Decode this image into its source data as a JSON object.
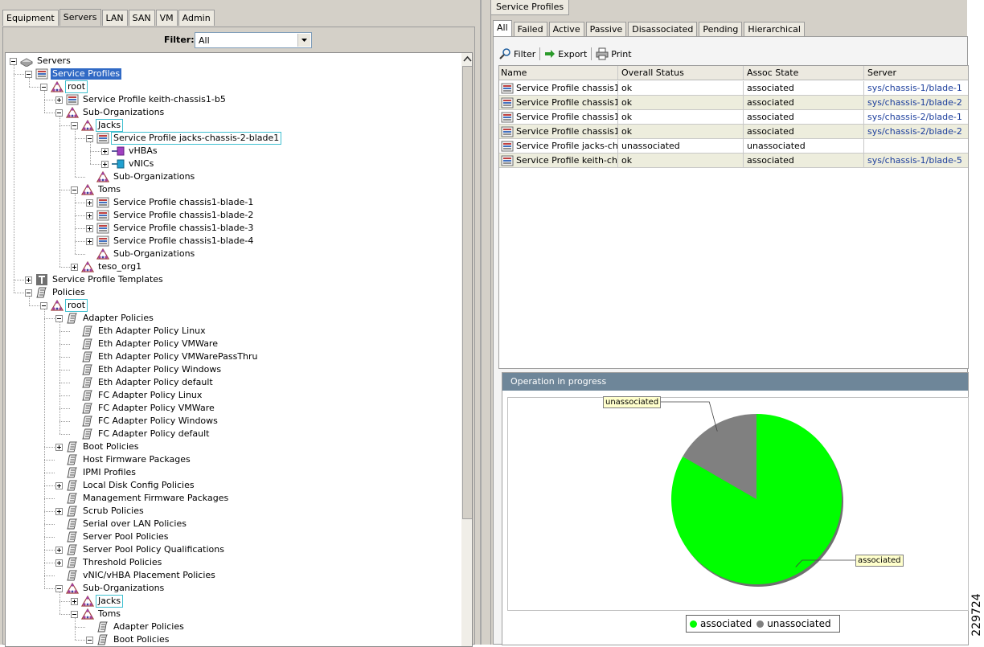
{
  "left_tabs": [
    "Equipment",
    "Servers",
    "LAN",
    "SAN",
    "VM",
    "Admin"
  ],
  "left_active_tab": "Servers",
  "filter": {
    "label": "Filter:",
    "value": "All"
  },
  "tree": [
    {
      "label": "Servers",
      "icon": "server-icon",
      "depth": 0,
      "exp": "minus",
      "style": ""
    },
    {
      "label": "Service Profiles",
      "icon": "service-profile-icon",
      "depth": 1,
      "exp": "minus",
      "style": "sel"
    },
    {
      "label": "root",
      "icon": "org-icon",
      "depth": 2,
      "exp": "minus",
      "style": "box"
    },
    {
      "label": "Service Profile keith-chassis1-b5",
      "icon": "service-profile-icon",
      "depth": 3,
      "exp": "plus",
      "style": ""
    },
    {
      "label": "Sub-Organizations",
      "icon": "org-icon",
      "depth": 3,
      "exp": "minus",
      "style": ""
    },
    {
      "label": "Jacks",
      "icon": "org-icon",
      "depth": 4,
      "exp": "minus",
      "style": "box"
    },
    {
      "label": "Service Profile jacks-chassis-2-blade1",
      "icon": "service-profile-icon",
      "depth": 5,
      "exp": "minus",
      "style": "box"
    },
    {
      "label": "vHBAs",
      "icon": "vhba-icon",
      "depth": 6,
      "exp": "plus",
      "style": ""
    },
    {
      "label": "vNICs",
      "icon": "vnic-icon",
      "depth": 6,
      "exp": "plus",
      "style": ""
    },
    {
      "label": "Sub-Organizations",
      "icon": "org-icon",
      "depth": 5,
      "exp": "none",
      "style": ""
    },
    {
      "label": "Toms",
      "icon": "org-icon",
      "depth": 4,
      "exp": "minus",
      "style": ""
    },
    {
      "label": "Service Profile chassis1-blade-1",
      "icon": "service-profile-icon",
      "depth": 5,
      "exp": "plus",
      "style": ""
    },
    {
      "label": "Service Profile chassis1-blade-2",
      "icon": "service-profile-icon",
      "depth": 5,
      "exp": "plus",
      "style": ""
    },
    {
      "label": "Service Profile chassis1-blade-3",
      "icon": "service-profile-icon",
      "depth": 5,
      "exp": "plus",
      "style": ""
    },
    {
      "label": "Service Profile chassis1-blade-4",
      "icon": "service-profile-icon",
      "depth": 5,
      "exp": "plus",
      "style": ""
    },
    {
      "label": "Sub-Organizations",
      "icon": "org-icon",
      "depth": 5,
      "exp": "none",
      "style": ""
    },
    {
      "label": "teso_org1",
      "icon": "org-icon",
      "depth": 4,
      "exp": "plus",
      "style": ""
    },
    {
      "label": "Service Profile Templates",
      "icon": "template-icon",
      "depth": 1,
      "exp": "plus",
      "style": ""
    },
    {
      "label": "Policies",
      "icon": "policy-icon",
      "depth": 1,
      "exp": "minus",
      "style": ""
    },
    {
      "label": "root",
      "icon": "org-icon",
      "depth": 2,
      "exp": "minus",
      "style": "box"
    },
    {
      "label": "Adapter Policies",
      "icon": "policy-icon",
      "depth": 3,
      "exp": "minus",
      "style": ""
    },
    {
      "label": "Eth Adapter Policy Linux",
      "icon": "policy-icon",
      "depth": 4,
      "exp": "none",
      "style": ""
    },
    {
      "label": "Eth Adapter Policy VMWare",
      "icon": "policy-icon",
      "depth": 4,
      "exp": "none",
      "style": ""
    },
    {
      "label": "Eth Adapter Policy VMWarePassThru",
      "icon": "policy-icon",
      "depth": 4,
      "exp": "none",
      "style": ""
    },
    {
      "label": "Eth Adapter Policy Windows",
      "icon": "policy-icon",
      "depth": 4,
      "exp": "none",
      "style": ""
    },
    {
      "label": "Eth Adapter Policy default",
      "icon": "policy-icon",
      "depth": 4,
      "exp": "none",
      "style": ""
    },
    {
      "label": "FC Adapter Policy Linux",
      "icon": "policy-icon",
      "depth": 4,
      "exp": "none",
      "style": ""
    },
    {
      "label": "FC Adapter Policy VMWare",
      "icon": "policy-icon",
      "depth": 4,
      "exp": "none",
      "style": ""
    },
    {
      "label": "FC Adapter Policy Windows",
      "icon": "policy-icon",
      "depth": 4,
      "exp": "none",
      "style": ""
    },
    {
      "label": "FC Adapter Policy default",
      "icon": "policy-icon",
      "depth": 4,
      "exp": "none",
      "style": ""
    },
    {
      "label": "Boot Policies",
      "icon": "policy-icon",
      "depth": 3,
      "exp": "plus",
      "style": ""
    },
    {
      "label": "Host Firmware Packages",
      "icon": "policy-icon",
      "depth": 3,
      "exp": "none",
      "style": ""
    },
    {
      "label": "IPMI Profiles",
      "icon": "policy-icon",
      "depth": 3,
      "exp": "none",
      "style": ""
    },
    {
      "label": "Local Disk Config Policies",
      "icon": "policy-icon",
      "depth": 3,
      "exp": "plus",
      "style": ""
    },
    {
      "label": "Management Firmware Packages",
      "icon": "policy-icon",
      "depth": 3,
      "exp": "none",
      "style": ""
    },
    {
      "label": "Scrub Policies",
      "icon": "policy-icon",
      "depth": 3,
      "exp": "plus",
      "style": ""
    },
    {
      "label": "Serial over LAN Policies",
      "icon": "policy-icon",
      "depth": 3,
      "exp": "none",
      "style": ""
    },
    {
      "label": "Server Pool Policies",
      "icon": "policy-icon",
      "depth": 3,
      "exp": "none",
      "style": ""
    },
    {
      "label": "Server Pool Policy Qualifications",
      "icon": "policy-icon",
      "depth": 3,
      "exp": "plus",
      "style": ""
    },
    {
      "label": "Threshold Policies",
      "icon": "policy-icon",
      "depth": 3,
      "exp": "plus",
      "style": ""
    },
    {
      "label": "vNIC/vHBA Placement Policies",
      "icon": "policy-icon",
      "depth": 3,
      "exp": "none",
      "style": ""
    },
    {
      "label": "Sub-Organizations",
      "icon": "org-icon",
      "depth": 3,
      "exp": "minus",
      "style": ""
    },
    {
      "label": "Jacks",
      "icon": "org-icon",
      "depth": 4,
      "exp": "plus",
      "style": "box"
    },
    {
      "label": "Toms",
      "icon": "org-icon",
      "depth": 4,
      "exp": "minus",
      "style": ""
    },
    {
      "label": "Adapter Policies",
      "icon": "policy-icon",
      "depth": 5,
      "exp": "none",
      "style": ""
    },
    {
      "label": "Boot Policies",
      "icon": "policy-icon",
      "depth": 5,
      "exp": "minus",
      "style": ""
    }
  ],
  "right_header": "Service Profiles",
  "sub_tabs": [
    "All",
    "Failed",
    "Active",
    "Passive",
    "Disassociated",
    "Pending",
    "Hierarchical"
  ],
  "active_sub_tab": "All",
  "toolbar": {
    "filter": "Filter",
    "export": "Export",
    "print": "Print"
  },
  "table": {
    "columns": [
      "Name",
      "Overall Status",
      "Assoc State",
      "Server"
    ],
    "rows": [
      {
        "name": "Service Profile chassis1...",
        "status": "ok",
        "assoc": "associated",
        "server": "sys/chassis-1/blade-1"
      },
      {
        "name": "Service Profile chassis1...",
        "status": "ok",
        "assoc": "associated",
        "server": "sys/chassis-1/blade-2"
      },
      {
        "name": "Service Profile chassis1...",
        "status": "ok",
        "assoc": "associated",
        "server": "sys/chassis-2/blade-1"
      },
      {
        "name": "Service Profile chassis1...",
        "status": "ok",
        "assoc": "associated",
        "server": "sys/chassis-2/blade-2"
      },
      {
        "name": "Service Profile jacks-ch...",
        "status": "unassociated",
        "assoc": "unassociated",
        "server": ""
      },
      {
        "name": "Service Profile keith-ch...",
        "status": "ok",
        "assoc": "associated",
        "server": "sys/chassis-1/blade-5"
      }
    ]
  },
  "operation": {
    "title": "Operation in progress"
  },
  "chart_data": {
    "type": "pie",
    "categories": [
      "associated",
      "unassociated"
    ],
    "values": [
      5,
      1
    ],
    "colors": [
      "#00ff00",
      "#808080"
    ],
    "legend": [
      "associated",
      "unassociated"
    ],
    "legend_position": "bottom"
  },
  "side_text": "229724"
}
